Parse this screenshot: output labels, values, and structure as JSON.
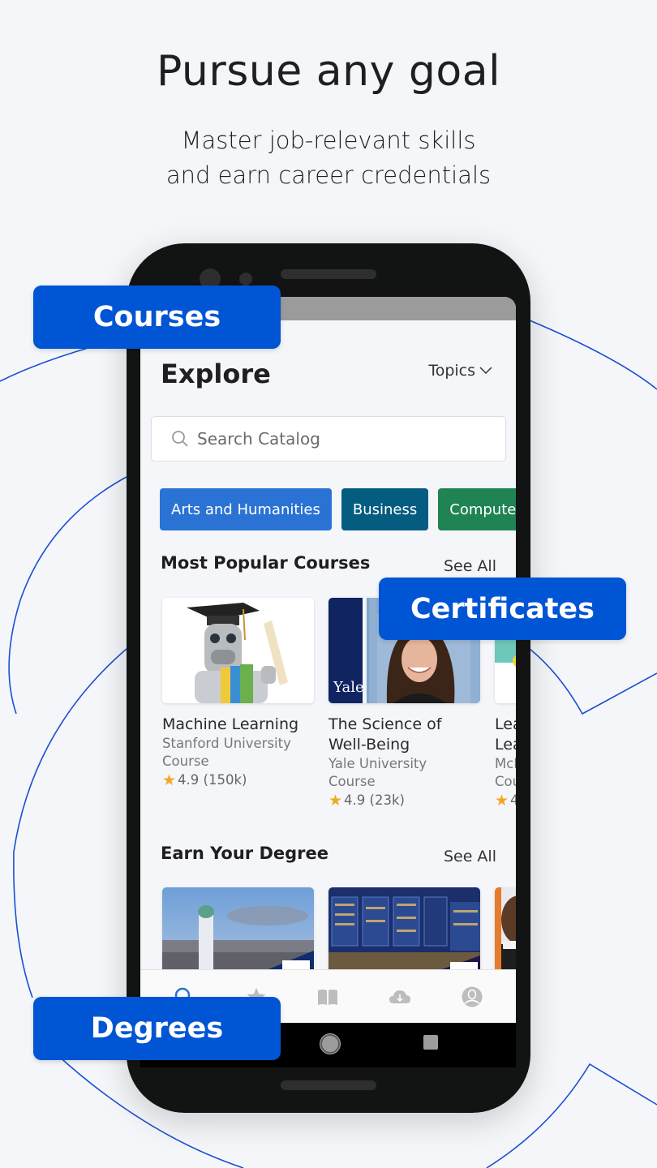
{
  "promo": {
    "headline": "Pursue any goal",
    "subline_1": "Master job-relevant skills",
    "subline_2": "and earn career credentials"
  },
  "badges": {
    "courses": "Courses",
    "certificates": "Certificates",
    "degrees": "Degrees"
  },
  "colors": {
    "badge_blue": "#0055d4",
    "chip_arts": "#2a73d4",
    "chip_business": "#045d80",
    "chip_computer": "#1f8353",
    "star": "#f5a623",
    "nav_active": "#2a73d4",
    "nav_inactive": "#bdbdbd"
  },
  "app": {
    "page_title": "Explore",
    "topics_label": "Topics",
    "search": {
      "placeholder": "Search Catalog",
      "value": ""
    },
    "chips": [
      {
        "label": "Arts and Humanities"
      },
      {
        "label": "Business"
      },
      {
        "label": "Computer"
      }
    ],
    "popular": {
      "title": "Most Popular Courses",
      "see_all": "See All",
      "courses": [
        {
          "title_1": "Machine Learning",
          "title_2": "",
          "provider": "Stanford University",
          "type": "Course",
          "rating": "4.9 (150k)"
        },
        {
          "title_1": "The Science of",
          "title_2": "Well-Being",
          "provider": "Yale University",
          "type": "Course",
          "rating": "4.9 (23k)",
          "logo_text": "Yale"
        },
        {
          "title_1": "Lea",
          "title_2": "Lea",
          "provider": "McM",
          "type": "Cou",
          "rating": "4"
        }
      ]
    },
    "degree": {
      "title": "Earn Your Degree",
      "see_all": "See All"
    },
    "bottom_nav": [
      {
        "icon": "search-icon",
        "active": true
      },
      {
        "icon": "star-icon",
        "active": false
      },
      {
        "icon": "book-icon",
        "active": false
      },
      {
        "icon": "download-cloud-icon",
        "active": false
      },
      {
        "icon": "profile-icon",
        "active": false
      }
    ]
  }
}
